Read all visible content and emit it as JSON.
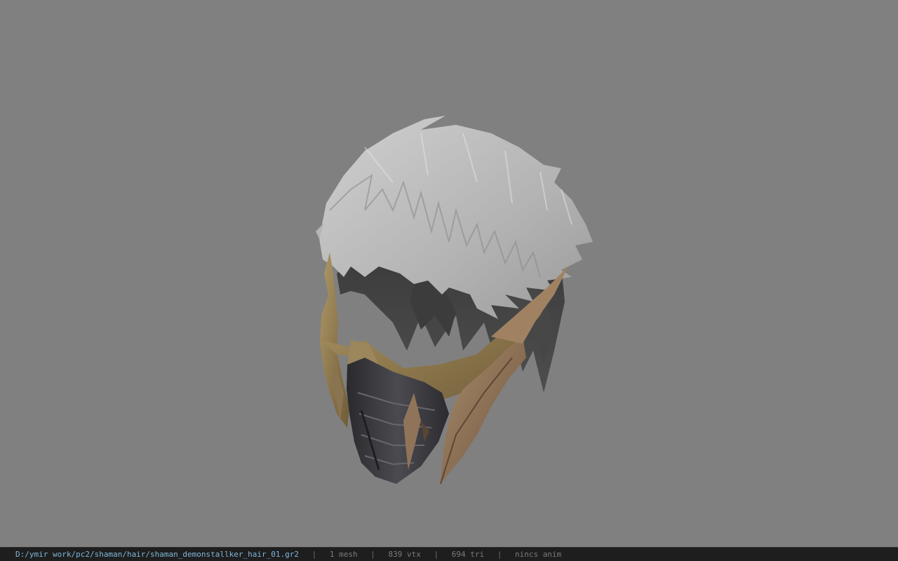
{
  "viewport": {
    "background_color": "#808080",
    "model_name": "hair-mask-model"
  },
  "status": {
    "file_path": "D:/ymir work/pc2/shaman/hair/shaman_demonstallker_hair_01.gr2",
    "separator": "|",
    "mesh_count": "1 mesh",
    "vertex_count": "839 vtx",
    "triangle_count": "694 tri",
    "anim_status": "nincs anim",
    "path_color": "#7fb6d9",
    "stat_color": "#7a7a7a"
  }
}
